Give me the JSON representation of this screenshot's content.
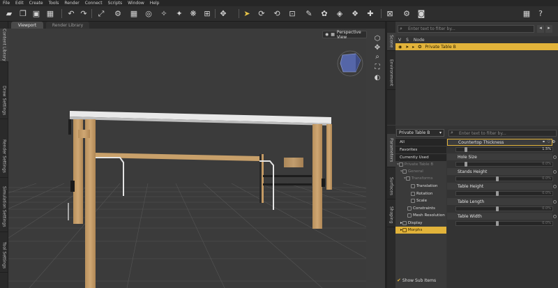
{
  "menu": [
    "File",
    "Edit",
    "Create",
    "Tools",
    "Render",
    "Connect",
    "Scripts",
    "Window",
    "Help"
  ],
  "toolbar_icons": [
    "open-folder-icon",
    "open-file-icon",
    "save-icon",
    "save-as-icon",
    "undo-icon",
    "redo-icon",
    "expand-icon",
    "tool-icon",
    "grid-icon",
    "node-select-icon",
    "pointer-icon",
    "rotate-icon",
    "translate-icon",
    "scale-icon",
    "transform-icon",
    "joint-editor-icon",
    "surface-icon",
    "region-icon",
    "geometry-icon",
    "spot-render-icon",
    "render-settings-icon",
    "render-icon",
    "help-icon"
  ],
  "left_tabs": [
    "Content Library",
    "Draw Settings",
    "Render Settings",
    "Simulation Settings",
    "Tool Settings"
  ],
  "viewport": {
    "tabs": [
      "Viewport",
      "Render Library"
    ],
    "view": "Perspective View"
  },
  "scene": {
    "tab_scene": "Scene",
    "tab_environment": "Environment",
    "filter_placeholder": "Enter text to filter by...",
    "col_vis": "V",
    "col_sel": "S",
    "col_node": "Node",
    "row": "Private Table B"
  },
  "params": {
    "tabs": [
      "Parameters",
      "Surfaces",
      "Shaping"
    ],
    "node": "Private Table B",
    "filter_placeholder": "Enter text to filter by...",
    "groups": [
      "All",
      "Favorites",
      "Currently Used",
      "Private Table B",
      "General",
      "Transforms",
      "Translation",
      "Rotation",
      "Scale",
      "Constraints",
      "Mesh Resolution",
      "Display",
      "Morphs"
    ],
    "props": [
      {
        "name": "Countertop Thickness",
        "value": "1.5%",
        "level": 0.02
      },
      {
        "name": "Hole Size",
        "value": "0.0%",
        "level": 0.02
      },
      {
        "name": "Stands Height",
        "value": "0.0%",
        "level": 0.43
      },
      {
        "name": "Table Height",
        "value": "0.0%",
        "level": 0.43
      },
      {
        "name": "Table Length",
        "value": "0.0%",
        "level": 0.43
      },
      {
        "name": "Table Width",
        "value": "0.0%",
        "level": 0.43
      }
    ],
    "show_sub": "Show Sub Items"
  },
  "colors": {
    "accent": "#e2b33a",
    "wood": "#c49a64",
    "panel": "#353535"
  }
}
